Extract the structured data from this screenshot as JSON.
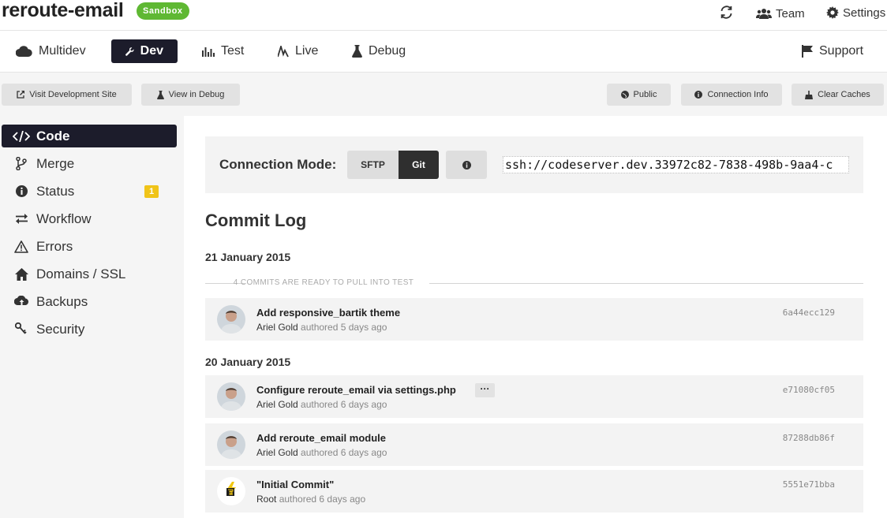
{
  "header": {
    "site_name": "reroute-email",
    "badge": "Sandbox",
    "team_label": "Team",
    "settings_label": "Settings"
  },
  "env_tabs": [
    {
      "label": "Multidev",
      "icon": "cloud-icon"
    },
    {
      "label": "Dev",
      "icon": "wrench-icon",
      "active": true
    },
    {
      "label": "Test",
      "icon": "bar-chart-icon"
    },
    {
      "label": "Live",
      "icon": "pulse-icon"
    },
    {
      "label": "Debug",
      "icon": "flask-icon"
    }
  ],
  "support_label": "Support",
  "toolbar": {
    "visit_site": "Visit Development Site",
    "view_debug": "View in Debug",
    "public": "Public",
    "connection_info": "Connection Info",
    "clear_caches": "Clear Caches"
  },
  "sidebar": {
    "items": [
      {
        "label": "Code",
        "icon": "code-icon",
        "active": true
      },
      {
        "label": "Merge",
        "icon": "branch-icon"
      },
      {
        "label": "Status",
        "icon": "info-icon",
        "badge": "1"
      },
      {
        "label": "Workflow",
        "icon": "exchange-icon"
      },
      {
        "label": "Errors",
        "icon": "warning-icon"
      },
      {
        "label": "Domains / SSL",
        "icon": "home-icon"
      },
      {
        "label": "Backups",
        "icon": "cloud-upload-icon"
      },
      {
        "label": "Security",
        "icon": "keys-icon"
      }
    ]
  },
  "connection": {
    "label": "Connection Mode:",
    "sftp": "SFTP",
    "git": "Git",
    "url": "ssh://codeserver.dev.33972c82-7838-498b-9aa4-c"
  },
  "commit_log": {
    "title": "Commit Log",
    "groups": [
      {
        "date": "21 January 2015",
        "ready_text": "4 COMMITS ARE READY TO PULL INTO TEST",
        "commits": [
          {
            "message": "Add responsive_bartik theme",
            "author": "Ariel Gold",
            "meta": "authored 5 days ago",
            "hash": "6a44ecc129"
          }
        ]
      },
      {
        "date": "20 January 2015",
        "commits": [
          {
            "message": "Configure reroute_email via settings.php",
            "author": "Ariel Gold",
            "meta": "authored 6 days ago",
            "hash": "e71080cf05",
            "more": "···"
          },
          {
            "message": "Add reroute_email module",
            "author": "Ariel Gold",
            "meta": "authored 6 days ago",
            "hash": "87288db86f"
          },
          {
            "message": "\"Initial Commit\"",
            "author": "Root",
            "meta": "authored 6 days ago",
            "hash": "5551e71bba"
          }
        ]
      }
    ]
  }
}
